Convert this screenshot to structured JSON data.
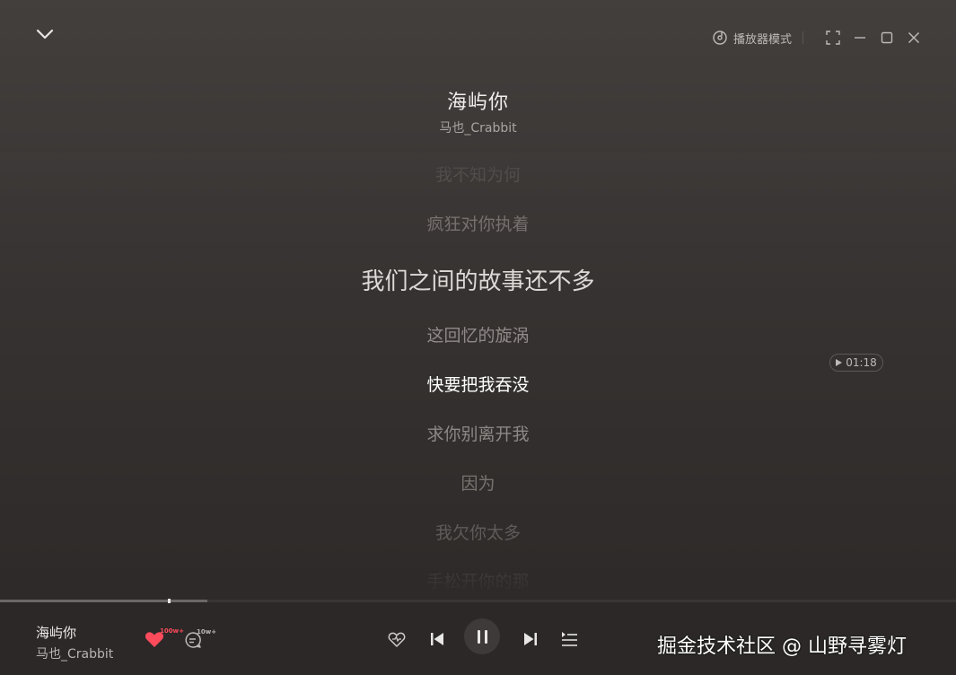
{
  "window": {
    "player_mode_label": "播放器模式"
  },
  "song": {
    "title": "海屿你",
    "artist": "马也_Crabbit"
  },
  "lyrics": {
    "lines": [
      "我不知为何",
      "疯狂对你执着",
      "我们之间的故事还不多",
      "这回忆的旋涡",
      "快要把我吞没",
      "求你别离开我",
      "因为",
      "我欠你太多",
      "手松开你的那"
    ],
    "seek_time": "01:18"
  },
  "playback": {
    "progress_fraction": 0.217,
    "state": "playing"
  },
  "bottom": {
    "title": "海屿你",
    "artist": "马也_Crabbit",
    "like_count": "100w+",
    "comment_count": "10w+"
  },
  "watermark": "掘金技术社区 @ 山野寻雾灯",
  "colors": {
    "accent_like": "#ff4b5c",
    "background_top": "#433f3d",
    "background_bottom": "#2b2827"
  }
}
